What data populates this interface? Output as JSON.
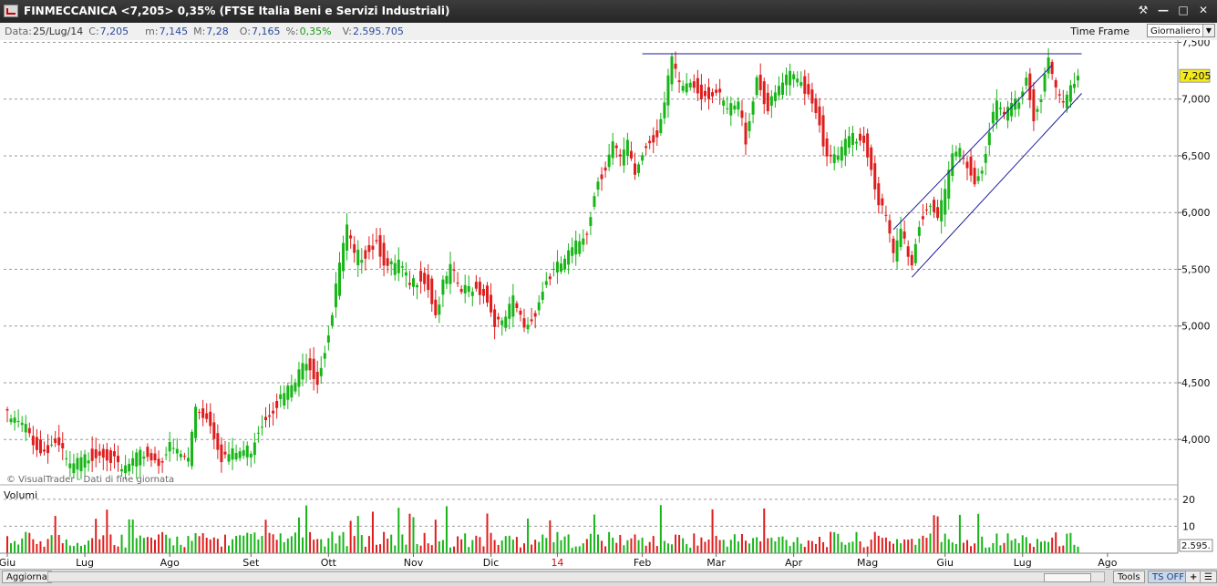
{
  "window": {
    "title": "FINMECCANICA <7,205> 0,35%  (FTSE Italia Beni e Servizi Industriali)",
    "buttons": [
      "tools-icon",
      "minimize-icon",
      "maximize-icon",
      "close-icon"
    ]
  },
  "info": {
    "data_label": "Data:",
    "data_value": "25/Lug/14",
    "c_label": "C:",
    "c_value": "7,205",
    "m_label": "m:",
    "m_value": "7,145",
    "M_label": "M:",
    "M_value": "7,28",
    "o_label": "O:",
    "o_value": "7,165",
    "pct_label": "%:",
    "pct_value": "0,35%",
    "v_label": "V:",
    "v_value": "2.595.705",
    "timeframe_label": "Time Frame",
    "timeframe_value": "Giornaliero"
  },
  "chart_data": {
    "type": "candlestick",
    "ylim": [
      3600,
      7520
    ],
    "y_ticks": [
      {
        "v": 7500,
        "label": "7,500"
      },
      {
        "v": 7000,
        "label": "7,000"
      },
      {
        "v": 6500,
        "label": "6,500"
      },
      {
        "v": 6000,
        "label": "6,000"
      },
      {
        "v": 5500,
        "label": "5,500"
      },
      {
        "v": 5000,
        "label": "5,000"
      },
      {
        "v": 4500,
        "label": "4,500"
      },
      {
        "v": 4000,
        "label": "4,000"
      }
    ],
    "last_price_label": "7,205",
    "last_price": 7.205,
    "watermark": "© VisualTrader - Dati di fine giornata",
    "x_labels": [
      {
        "label": "Giu",
        "i": 0
      },
      {
        "label": "Lug",
        "i": 21
      },
      {
        "label": "Ago",
        "i": 44
      },
      {
        "label": "Set",
        "i": 66
      },
      {
        "label": "Ott",
        "i": 87
      },
      {
        "label": "Nov",
        "i": 110
      },
      {
        "label": "Dic",
        "i": 131
      },
      {
        "label": "14",
        "i": 149,
        "year": true
      },
      {
        "label": "Feb",
        "i": 172
      },
      {
        "label": "Mar",
        "i": 192
      },
      {
        "label": "Apr",
        "i": 213
      },
      {
        "label": "Mag",
        "i": 233
      },
      {
        "label": "Giu",
        "i": 254
      },
      {
        "label": "Lug",
        "i": 275
      },
      {
        "label": "Ago",
        "i": 298
      }
    ],
    "close_anchors": [
      [
        0,
        4.2
      ],
      [
        5,
        4.1
      ],
      [
        9,
        3.88
      ],
      [
        13,
        3.98
      ],
      [
        17,
        3.75
      ],
      [
        22,
        3.85
      ],
      [
        26,
        3.9
      ],
      [
        31,
        3.72
      ],
      [
        37,
        3.88
      ],
      [
        41,
        3.8
      ],
      [
        44,
        3.93
      ],
      [
        49,
        3.82
      ],
      [
        51,
        4.3
      ],
      [
        55,
        4.15
      ],
      [
        58,
        3.85
      ],
      [
        62,
        3.88
      ],
      [
        66,
        3.92
      ],
      [
        68,
        4.1
      ],
      [
        71,
        4.25
      ],
      [
        75,
        4.4
      ],
      [
        78,
        4.5
      ],
      [
        81,
        4.72
      ],
      [
        84,
        4.52
      ],
      [
        86,
        4.8
      ],
      [
        88,
        5.1
      ],
      [
        90,
        5.55
      ],
      [
        92,
        5.85
      ],
      [
        94,
        5.6
      ],
      [
        97,
        5.65
      ],
      [
        100,
        5.75
      ],
      [
        103,
        5.5
      ],
      [
        106,
        5.55
      ],
      [
        109,
        5.35
      ],
      [
        112,
        5.45
      ],
      [
        114,
        5.35
      ],
      [
        116,
        5.1
      ],
      [
        118,
        5.35
      ],
      [
        120,
        5.5
      ],
      [
        123,
        5.3
      ],
      [
        126,
        5.35
      ],
      [
        129,
        5.3
      ],
      [
        132,
        5.05
      ],
      [
        134,
        5.0
      ],
      [
        137,
        5.22
      ],
      [
        140,
        5.0
      ],
      [
        142,
        5.05
      ],
      [
        146,
        5.4
      ],
      [
        150,
        5.55
      ],
      [
        154,
        5.7
      ],
      [
        157,
        5.85
      ],
      [
        160,
        6.3
      ],
      [
        162,
        6.4
      ],
      [
        164,
        6.6
      ],
      [
        166,
        6.45
      ],
      [
        168,
        6.6
      ],
      [
        170,
        6.35
      ],
      [
        173,
        6.6
      ],
      [
        176,
        6.7
      ],
      [
        178,
        6.95
      ],
      [
        180,
        7.35
      ],
      [
        182,
        7.1
      ],
      [
        185,
        7.15
      ],
      [
        188,
        7.05
      ],
      [
        192,
        7.05
      ],
      [
        195,
        6.9
      ],
      [
        198,
        6.95
      ],
      [
        200,
        6.65
      ],
      [
        203,
        7.2
      ],
      [
        206,
        6.9
      ],
      [
        209,
        7.1
      ],
      [
        212,
        7.2
      ],
      [
        215,
        7.15
      ],
      [
        218,
        7.0
      ],
      [
        220,
        6.8
      ],
      [
        222,
        6.45
      ],
      [
        225,
        6.5
      ],
      [
        228,
        6.65
      ],
      [
        232,
        6.65
      ],
      [
        234,
        6.4
      ],
      [
        236,
        6.1
      ],
      [
        238,
        5.95
      ],
      [
        240,
        5.6
      ],
      [
        242,
        5.85
      ],
      [
        245,
        5.55
      ],
      [
        247,
        5.9
      ],
      [
        250,
        6.1
      ],
      [
        252,
        5.95
      ],
      [
        254,
        6.15
      ],
      [
        256,
        6.5
      ],
      [
        258,
        6.55
      ],
      [
        260,
        6.45
      ],
      [
        262,
        6.25
      ],
      [
        264,
        6.4
      ],
      [
        266,
        6.75
      ],
      [
        268,
        6.95
      ],
      [
        270,
        6.85
      ],
      [
        272,
        6.95
      ],
      [
        274,
        7.0
      ],
      [
        276,
        7.2
      ],
      [
        278,
        6.85
      ],
      [
        280,
        7.05
      ],
      [
        282,
        7.35
      ],
      [
        284,
        7.05
      ],
      [
        286,
        6.95
      ],
      [
        288,
        7.1
      ],
      [
        290,
        7.205
      ]
    ],
    "trendlines": [
      {
        "name": "resistance",
        "from": [
          172,
          7.4
        ],
        "to": [
          291,
          7.4
        ]
      },
      {
        "name": "channel-upper",
        "from": [
          240,
          5.85
        ],
        "to": [
          283,
          7.3
        ]
      },
      {
        "name": "channel-lower",
        "from": [
          245,
          5.43
        ],
        "to": [
          291,
          7.05
        ]
      }
    ],
    "volume": {
      "label": "Volumi",
      "y_ticks": [
        {
          "v": 20,
          "label": "20"
        },
        {
          "v": 10,
          "label": "10"
        }
      ],
      "last_label": "2.595."
    },
    "colors": {
      "up": "#17b517",
      "down": "#e01d1d",
      "grid": "#9a9a9a",
      "trend": "#1a1a9a",
      "price_tag": "#f4ea18"
    }
  },
  "footer": {
    "refresh_button": "Aggiorna",
    "tools_button": "Tools",
    "ts_button": "TS OFF"
  }
}
